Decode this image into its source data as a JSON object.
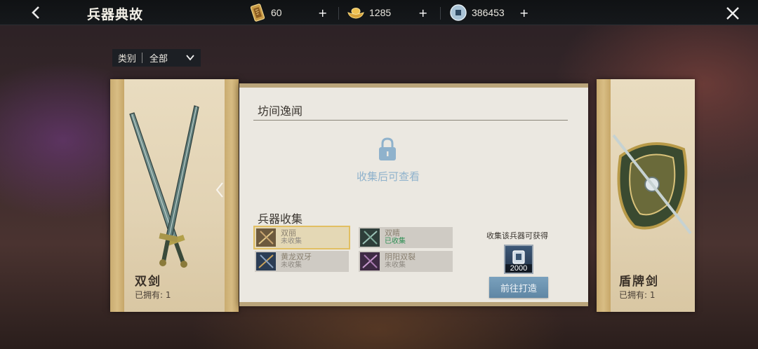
{
  "header": {
    "title": "兵器典故",
    "resources": [
      {
        "icon": "token-card-icon",
        "value": "60"
      },
      {
        "icon": "gold-ingot-icon",
        "value": "1285"
      },
      {
        "icon": "silver-coin-icon",
        "value": "386453"
      }
    ],
    "plus_symbol": "+"
  },
  "filter": {
    "label": "类别",
    "value": "全部"
  },
  "left_card": {
    "name": "双剑",
    "owned": "已拥有: 1"
  },
  "right_card": {
    "name": "盾牌剑",
    "owned": "已拥有: 1"
  },
  "story": {
    "title": "坊间逸闻",
    "locked_text": "收集后可查看"
  },
  "collection": {
    "title": "兵器收集",
    "items": [
      {
        "name": "双丽",
        "status": "未收集"
      },
      {
        "name": "双睛",
        "status": "已收集"
      },
      {
        "name": "黄龙双牙",
        "status": "未收集"
      },
      {
        "name": "阴阳双裂",
        "status": "未收集"
      }
    ],
    "reward_label": "收集该兵器可获得",
    "reward_count": "2000",
    "go_button": "前往打造"
  },
  "colors": {
    "accent_blue": "#6f95b3",
    "collected_green": "#2f8f55",
    "selected_gold": "#e1bf62"
  }
}
